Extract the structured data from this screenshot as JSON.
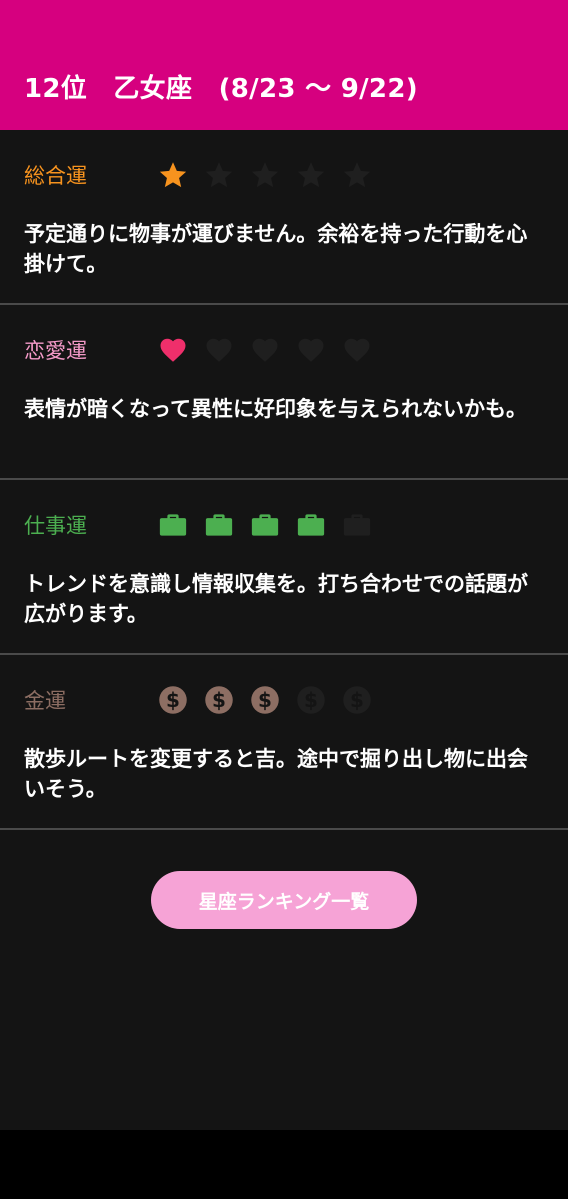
{
  "header": {
    "title": "12位　乙女座　(8/23 〜 9/22)"
  },
  "sections": [
    {
      "label": "総合運",
      "label_color": "#f7931e",
      "icon": "star-icon",
      "rating": 1,
      "max": 5,
      "active_color": "#f7931e",
      "text": "予定通りに物事が運びません。余裕を持った行動を心掛けて。"
    },
    {
      "label": "恋愛運",
      "label_color": "#f49ac8",
      "icon": "heart-icon",
      "rating": 1,
      "max": 5,
      "active_color": "#ef2f6b",
      "text": "表情が暗くなって異性に好印象を与えられないかも。"
    },
    {
      "label": "仕事運",
      "label_color": "#4caf50",
      "icon": "briefcase-icon",
      "rating": 4,
      "max": 5,
      "active_color": "#4caf50",
      "text": "トレンドを意識し情報収集を。打ち合わせでの話題が広がります。"
    },
    {
      "label": "金運",
      "label_color": "#8d6e63",
      "icon": "dollar-coin-icon",
      "rating": 3,
      "max": 5,
      "active_color": "#8d6e63",
      "text": "散歩ルートを変更すると吉。途中で掘り出し物に出会いそう。"
    }
  ],
  "inactive_icon_color": "#1f1f1f",
  "ranking_button": {
    "label": "星座ランキング一覧"
  }
}
